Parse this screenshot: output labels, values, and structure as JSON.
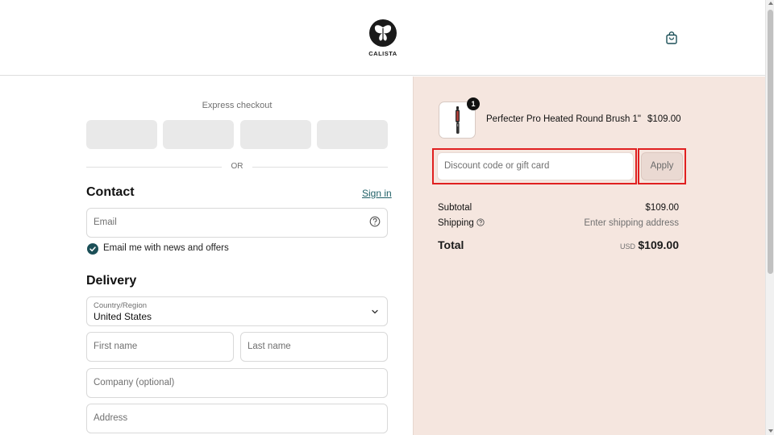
{
  "header": {
    "brand": "CALISTA"
  },
  "checkout": {
    "express_title": "Express checkout",
    "or_text": "OR",
    "contact": {
      "title": "Contact",
      "signin": "Sign in",
      "email_placeholder": "Email",
      "newsletter_label": "Email me with news and offers",
      "newsletter_checked": true
    },
    "delivery": {
      "title": "Delivery",
      "country_label": "Country/Region",
      "country_value": "United States",
      "first_name_placeholder": "First name",
      "last_name_placeholder": "Last name",
      "company_placeholder": "Company (optional)",
      "address_placeholder": "Address"
    }
  },
  "summary": {
    "item": {
      "quantity": "1",
      "name": "Perfecter Pro Heated Round Brush 1\"",
      "price": "$109.00"
    },
    "discount_placeholder": "Discount code or gift card",
    "apply_label": "Apply",
    "subtotal_label": "Subtotal",
    "subtotal_value": "$109.00",
    "shipping_label": "Shipping",
    "shipping_value": "Enter shipping address",
    "total_label": "Total",
    "total_currency": "USD",
    "total_value": "$109.00"
  },
  "colors": {
    "accent": "#1b4f57",
    "summary_bg": "#f5e6df",
    "highlight": "#e02020"
  }
}
